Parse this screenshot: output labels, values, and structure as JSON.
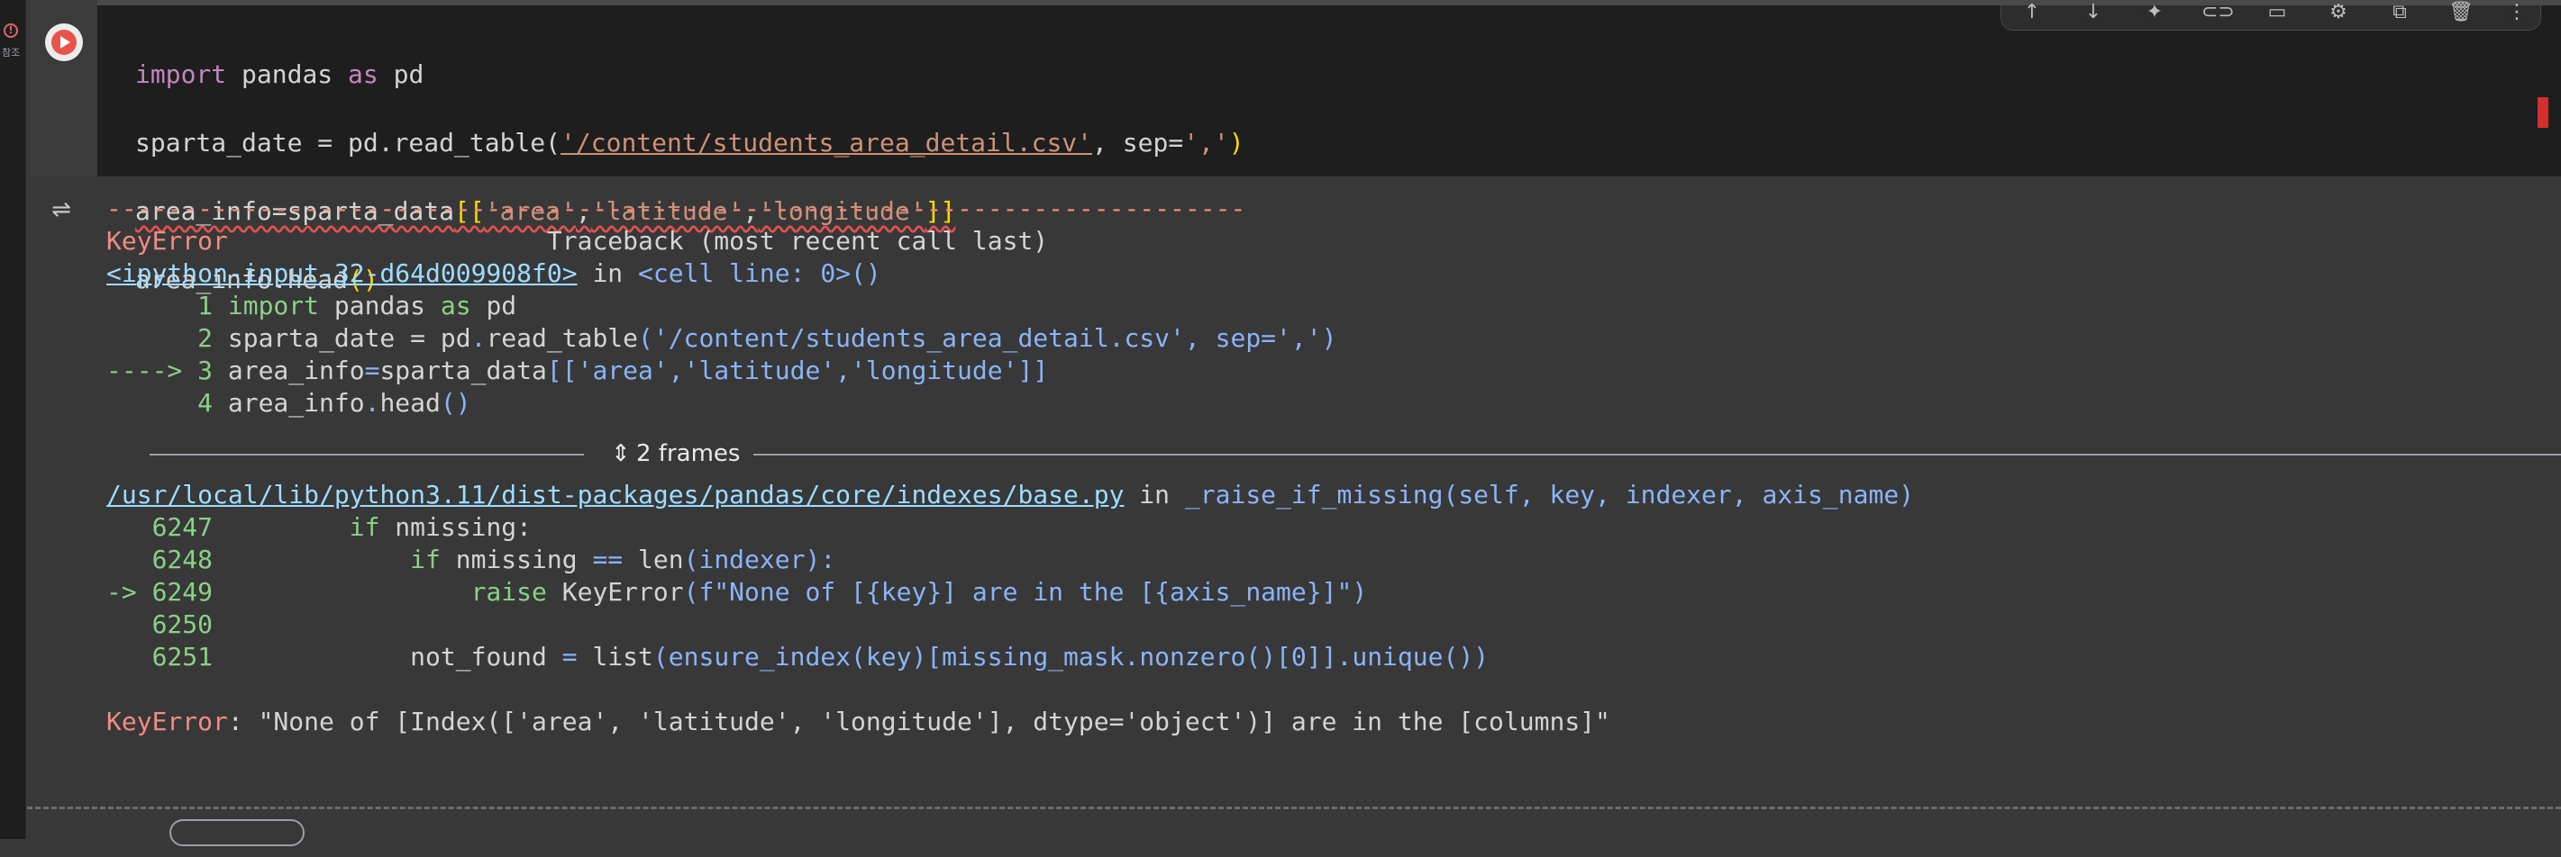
{
  "gutter": {
    "warning_glyph": "!",
    "label": "참조"
  },
  "cell": {
    "code": {
      "line1": {
        "kw1": "import",
        "mod": " pandas ",
        "kw2": "as",
        "alias": " pd"
      },
      "line2": {
        "pre": "sparta_date = pd.read_table(",
        "path": "'/content/students_area_detail.csv'",
        "mid": ", sep=",
        "sep": "','",
        "close": ")"
      },
      "line3": {
        "pre": "area_info=sparta_data",
        "open": "[[",
        "a": "'area'",
        "c1": ",",
        "b": "'latitude'",
        "c2": ",",
        "c": "'longitude'",
        "close": "]]"
      },
      "line4": {
        "pre": "area_info.head",
        "paren": "()"
      }
    }
  },
  "output": {
    "dashes": "---------------------------------------------------------------------------",
    "error_name": "KeyError",
    "traceback_header": "                     Traceback (most recent call last)",
    "input_link": "<ipython-input-32-d64d009908f0>",
    "in_text": " in ",
    "cell_line": "<cell line: 0>()",
    "tb1": {
      "l1_num": "      1 ",
      "l1_kw": "import",
      "l1_rest": " pandas ",
      "l1_as": "as",
      "l1_pd": " pd",
      "l2_num": "      2 ",
      "l2_pre": "sparta_date = pd",
      "l2_dot": ".",
      "l2_fn": "read_table",
      "l2_args": "('/content/students_area_detail.csv', sep=',')",
      "l3_num": "----> 3 ",
      "l3_pre": "area_info",
      "l3_eq": "=",
      "l3_mid": "sparta_data",
      "l3_args": "[['area','latitude','longitude']]",
      "l4_num": "      4 ",
      "l4_pre": "area_info",
      "l4_dot": ".",
      "l4_fn": "head",
      "l4_paren": "()"
    },
    "frames_label": "2 frames",
    "base_link": "/usr/local/lib/python3.11/dist-packages/pandas/core/indexes/base.py",
    "base_in": " in ",
    "base_fn": "_raise_if_missing(self, key, indexer, axis_name)",
    "tb2": {
      "l6247_num": "   6247         ",
      "l6247_kw": "if",
      "l6247_rest": " nmissing:",
      "l6248_num": "   6248             ",
      "l6248_kw": "if",
      "l6248_rest": " nmissing ",
      "l6248_eq": "==",
      "l6248_len": " len",
      "l6248_args": "(indexer):",
      "l6249_num": "-> 6249                 ",
      "l6249_kw": "raise",
      "l6249_rest": " KeyError",
      "l6249_args": "(f\"None of [{key}] are in the [{axis_name}]\")",
      "l6250_num": "   6250",
      "l6251_num": "   6251             ",
      "l6251_pre": "not_found ",
      "l6251_eq": "=",
      "l6251_mid": " list",
      "l6251_args": "(ensure_index(key)[missing_mask.nonzero()[0]].unique())"
    },
    "final_error_name": "KeyError",
    "final_error_msg": ": \"None of [Index(['area', 'latitude', 'longitude'], dtype='object')] are in the [columns]\""
  },
  "bottom": {
    "text": "",
    "chip": ""
  }
}
